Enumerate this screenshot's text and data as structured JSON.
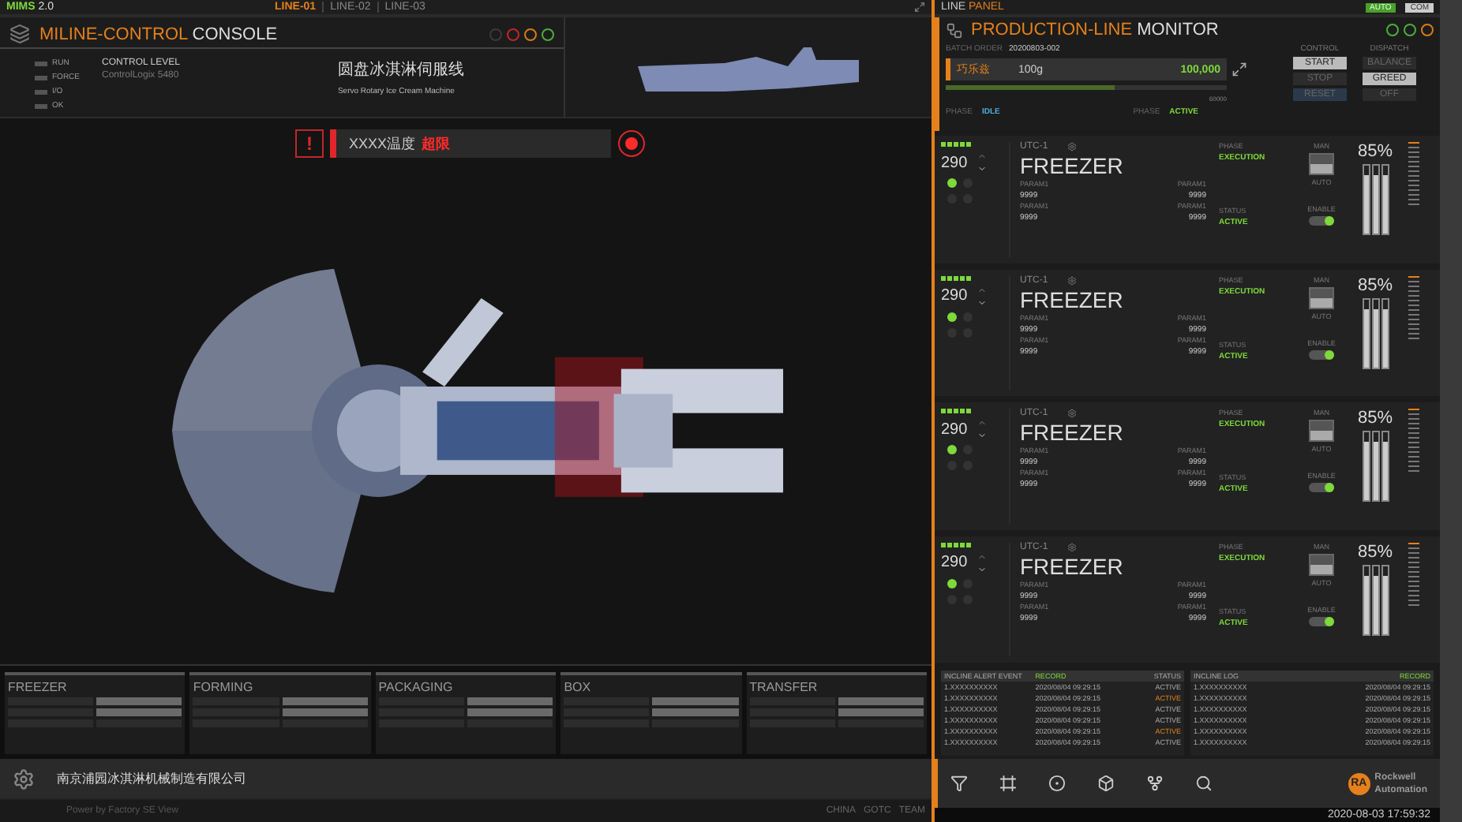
{
  "top_bar": {
    "app": "MIMS",
    "version": "2.0",
    "lines": [
      {
        "label": "LINE-01",
        "selected": true
      },
      {
        "label": "LINE-02",
        "selected": false
      },
      {
        "label": "LINE-03",
        "selected": false
      }
    ]
  },
  "console": {
    "title_accent": "MILINE-CONTROL",
    "title": "CONSOLE",
    "lamps": [
      {
        "color": "#3a3a3a"
      },
      {
        "color": "#c0262a"
      },
      {
        "color": "#d97a18"
      },
      {
        "color": "#4cae3a"
      }
    ],
    "indicators": [
      "RUN",
      "FORCE",
      "I/O",
      "OK"
    ],
    "control_level_label": "CONTROL LEVEL",
    "control_level": "ControlLogix 5480",
    "machine_cn": "圆盘冰淇淋伺服线",
    "machine_en": "Servo Rotary Ice Cream Machine"
  },
  "alert": {
    "icon": "!",
    "text": "XXXX温度",
    "highlight": "超限"
  },
  "stations": [
    "FREEZER",
    "FORMING",
    "PACKAGING",
    "BOX",
    "TRANSFER"
  ],
  "footer": {
    "company": "南京浦园冰淇淋机械制造有限公司",
    "power": "Power by Factory SE View",
    "tags": [
      "CHINA",
      "GOTC",
      "TEAM"
    ]
  },
  "panel": {
    "title": "LINE",
    "title_accent": "PANEL",
    "badges": [
      {
        "label": "AUTO",
        "selected": true
      },
      {
        "label": "COM",
        "selected": false
      }
    ]
  },
  "monitor": {
    "title_accent": "PRODUCTION-LINE",
    "title": "MONITOR",
    "lamps": [
      {
        "color": "#4cae3a"
      },
      {
        "color": "#4cae3a"
      },
      {
        "color": "#d97a18"
      }
    ],
    "batch_label": "BATCH ORDER",
    "batch": "20200803-002",
    "product": "巧乐兹",
    "weight": "100g",
    "count": "100,000",
    "max": "60000",
    "level": 0.6,
    "phases": [
      {
        "label": "PHASE",
        "value": "IDLE",
        "kind": "idle"
      },
      {
        "label": "PHASE",
        "value": "ACTIVE",
        "kind": "active"
      }
    ],
    "control_label": "CONTROL",
    "control": [
      {
        "label": "START",
        "selected": true
      },
      {
        "label": "STOP",
        "selected": false
      },
      {
        "label": "RESET",
        "selected": false
      }
    ],
    "dispatch_label": "DISPATCH",
    "dispatch": [
      {
        "label": "BALANCE",
        "selected": false
      },
      {
        "label": "GREED",
        "selected": true
      },
      {
        "label": "OFF",
        "selected": false
      }
    ]
  },
  "units": [
    {
      "speed": "290",
      "code": "UTC-1",
      "name": "FREEZER",
      "params": [
        {
          "label": "PARAM1",
          "value": "9999"
        },
        {
          "label": "PARAM1",
          "value": "9999"
        },
        {
          "label": "PARAM1",
          "value": "9999"
        },
        {
          "label": "PARAM1",
          "value": "9999"
        }
      ],
      "phase_label": "PHASE",
      "phase": "EXECUTION",
      "status_label": "STATUS",
      "status": "ACTIVE",
      "man_label": "MAN",
      "auto_label": "AUTO",
      "auto": true,
      "enable_label": "ENABLE",
      "enabled": true,
      "percent": "85%",
      "level": 0.85
    },
    {
      "speed": "290",
      "code": "UTC-1",
      "name": "FREEZER",
      "params": [
        {
          "label": "PARAM1",
          "value": "9999"
        },
        {
          "label": "PARAM1",
          "value": "9999"
        },
        {
          "label": "PARAM1",
          "value": "9999"
        },
        {
          "label": "PARAM1",
          "value": "9999"
        }
      ],
      "phase_label": "PHASE",
      "phase": "EXECUTION",
      "status_label": "STATUS",
      "status": "ACTIVE",
      "man_label": "MAN",
      "auto_label": "AUTO",
      "auto": true,
      "enable_label": "ENABLE",
      "enabled": true,
      "percent": "85%",
      "level": 0.85
    },
    {
      "speed": "290",
      "code": "UTC-1",
      "name": "FREEZER",
      "params": [
        {
          "label": "PARAM1",
          "value": "9999"
        },
        {
          "label": "PARAM1",
          "value": "9999"
        },
        {
          "label": "PARAM1",
          "value": "9999"
        },
        {
          "label": "PARAM1",
          "value": "9999"
        }
      ],
      "phase_label": "PHASE",
      "phase": "EXECUTION",
      "status_label": "STATUS",
      "status": "ACTIVE",
      "man_label": "MAN",
      "auto_label": "AUTO",
      "auto": true,
      "enable_label": "ENABLE",
      "enabled": true,
      "percent": "85%",
      "level": 0.85
    },
    {
      "speed": "290",
      "code": "UTC-1",
      "name": "FREEZER",
      "params": [
        {
          "label": "PARAM1",
          "value": "9999"
        },
        {
          "label": "PARAM1",
          "value": "9999"
        },
        {
          "label": "PARAM1",
          "value": "9999"
        },
        {
          "label": "PARAM1",
          "value": "9999"
        }
      ],
      "phase_label": "PHASE",
      "phase": "EXECUTION",
      "status_label": "STATUS",
      "status": "ACTIVE",
      "man_label": "MAN",
      "auto_label": "AUTO",
      "auto": true,
      "enable_label": "ENABLE",
      "enabled": true,
      "percent": "85%",
      "level": 0.85
    }
  ],
  "alert_table": {
    "columns": [
      "INCLINE ALERT EVENT",
      "RECORD",
      "STATUS"
    ],
    "rows": [
      {
        "event": "1.XXXXXXXXXX",
        "record": "2020/08/04 09:29:15",
        "status": "ACTIVE",
        "warning": false
      },
      {
        "event": "1.XXXXXXXXXX",
        "record": "2020/08/04 09:29:15",
        "status": "ACTIVE",
        "warning": true
      },
      {
        "event": "1.XXXXXXXXXX",
        "record": "2020/08/04 09:29:15",
        "status": "ACTIVE",
        "warning": false
      },
      {
        "event": "1.XXXXXXXXXX",
        "record": "2020/08/04 09:29:15",
        "status": "ACTIVE",
        "warning": false
      },
      {
        "event": "1.XXXXXXXXXX",
        "record": "2020/08/04 09:29:15",
        "status": "ACTIVE",
        "warning": true
      },
      {
        "event": "1.XXXXXXXXXX",
        "record": "2020/08/04 09:29:15",
        "status": "ACTIVE",
        "warning": false
      }
    ]
  },
  "log_table": {
    "columns": [
      "INCLINE LOG",
      "RECORD"
    ],
    "rows": [
      {
        "event": "1.XXXXXXXXXX",
        "record": "2020/08/04 09:29:15"
      },
      {
        "event": "1.XXXXXXXXXX",
        "record": "2020/08/04 09:29:15"
      },
      {
        "event": "1.XXXXXXXXXX",
        "record": "2020/08/04 09:29:15"
      },
      {
        "event": "1.XXXXXXXXXX",
        "record": "2020/08/04 09:29:15"
      },
      {
        "event": "1.XXXXXXXXXX",
        "record": "2020/08/04 09:29:15"
      },
      {
        "event": "1.XXXXXXXXXX",
        "record": "2020/08/04 09:29:15"
      }
    ]
  },
  "toolbar": [
    {
      "kind": "filter"
    },
    {
      "kind": "frame"
    },
    {
      "kind": "target"
    },
    {
      "kind": "cube"
    },
    {
      "kind": "branch"
    },
    {
      "kind": "search"
    }
  ],
  "logo": {
    "mark": "RA",
    "line1": "Rockwell",
    "line2": "Automation"
  },
  "clock": "2020-08-03 17:59:32"
}
